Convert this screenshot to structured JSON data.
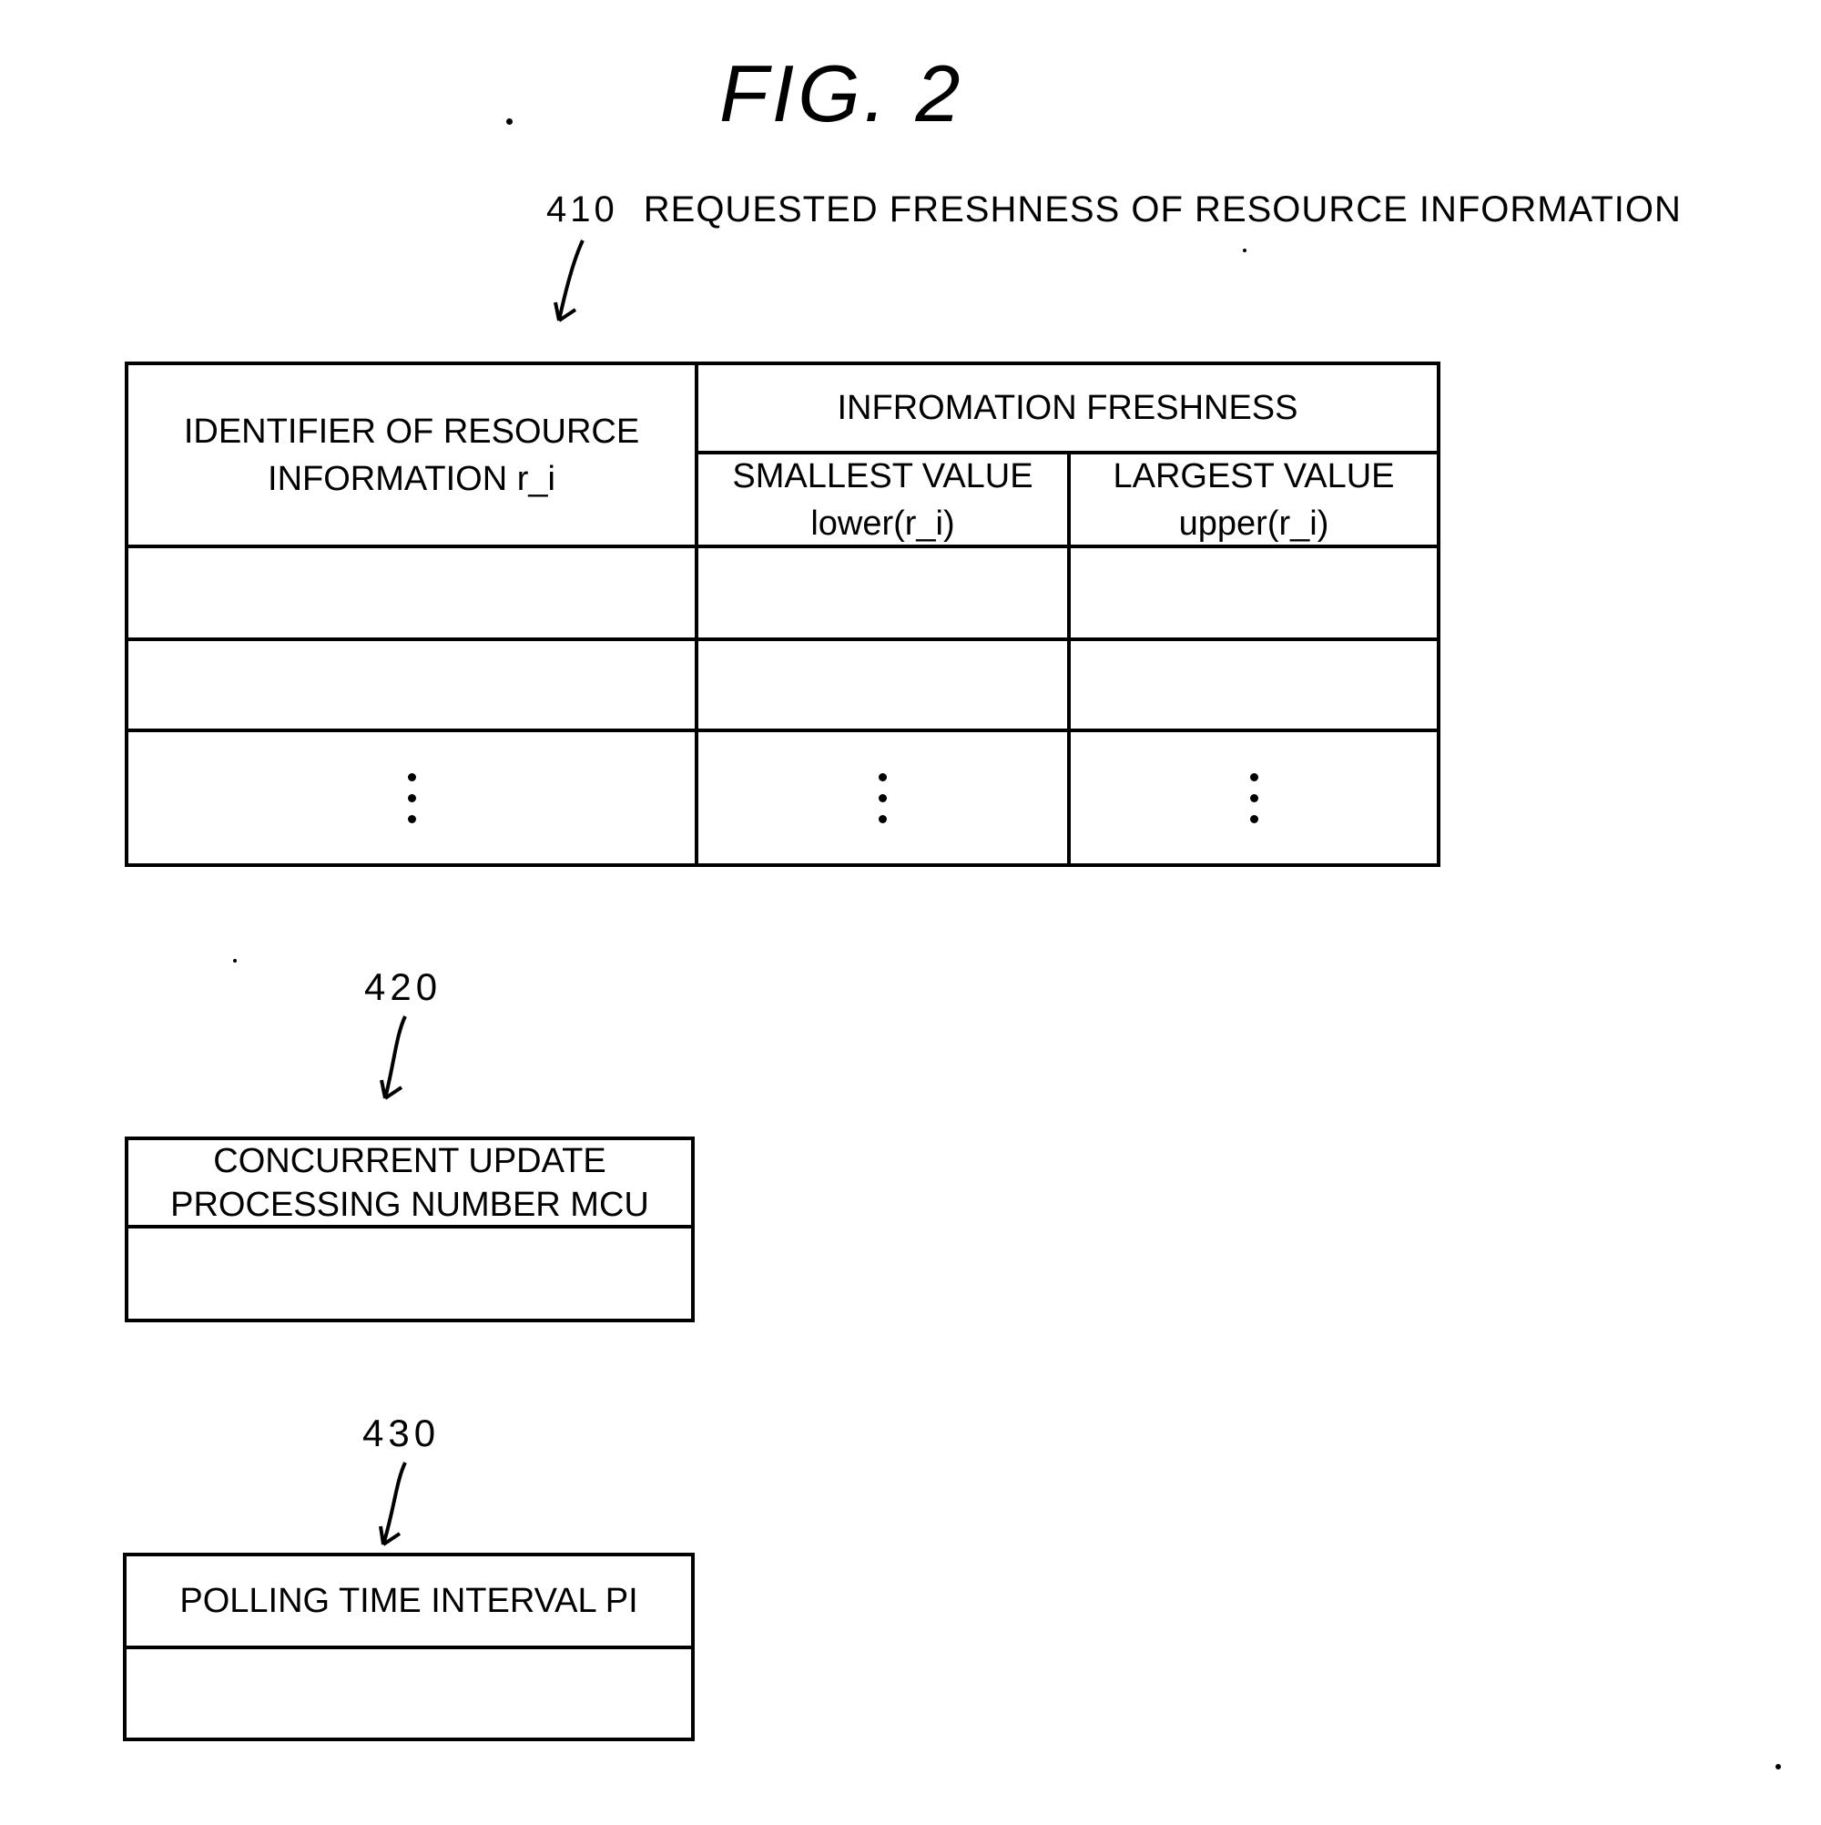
{
  "figure": {
    "title": "FIG. 2"
  },
  "table_410": {
    "ref": "410",
    "caption": "REQUESTED FRESHNESS OF RESOURCE INFORMATION",
    "headers": {
      "identifier": "IDENTIFIER OF RESOURCE INFORMATION r_i",
      "freshness_group": "INFROMATION FRESHNESS",
      "smallest_value": "SMALLEST VALUE",
      "smallest_value_sub": "lower(r_i)",
      "largest_value": "LARGEST VALUE",
      "largest_value_sub": "upper(r_i)"
    },
    "rows": [
      {
        "identifier": "",
        "lower": "",
        "upper": ""
      },
      {
        "identifier": "",
        "lower": "",
        "upper": ""
      },
      {
        "identifier": "⋮",
        "lower": "⋮",
        "upper": "⋮"
      }
    ]
  },
  "box_420": {
    "ref": "420",
    "header_line1": "CONCURRENT UPDATE",
    "header_line2": "PROCESSING NUMBER MCU",
    "value": ""
  },
  "box_430": {
    "ref": "430",
    "header": "POLLING TIME INTERVAL PI",
    "value": ""
  }
}
